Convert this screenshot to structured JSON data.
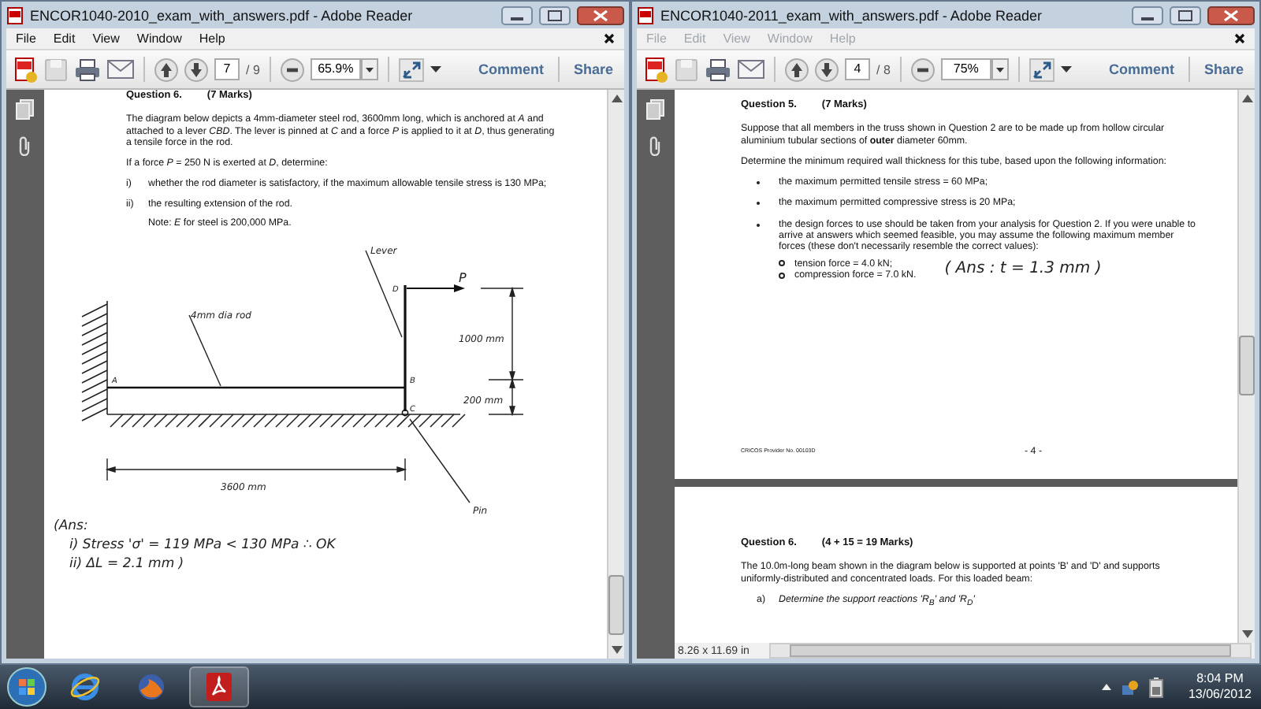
{
  "windows": [
    {
      "title": "ENCOR1040-2010_exam_with_answers.pdf - Adobe Reader",
      "menu": [
        "File",
        "Edit",
        "View",
        "Window",
        "Help"
      ],
      "menu_disabled": false,
      "page_number": "7",
      "page_count": "/ 9",
      "zoom": "65.9%",
      "comment": "Comment",
      "share": "Share"
    },
    {
      "title": "ENCOR1040-2011_exam_with_answers.pdf - Adobe Reader",
      "menu": [
        "File",
        "Edit",
        "View",
        "Window",
        "Help"
      ],
      "menu_disabled": true,
      "page_number": "4",
      "page_count": "/ 8",
      "zoom": "75%",
      "comment": "Comment",
      "share": "Share"
    }
  ],
  "left_document": {
    "heading": "Question 6.",
    "marks": "(7 Marks)",
    "paragraphs": [
      "The diagram below depicts a 4mm-diameter steel rod, 3600mm long, which is anchored at *A* and attached to a lever *CBD*. The lever is pinned at *C* and a force *P* is applied to it at *D*, thus generating a tensile force in the rod.",
      "If a force *P* = 250 N is exerted at *D*, determine:"
    ],
    "items": [
      {
        "marker": "i)",
        "text": "whether the rod diameter is satisfactory, if the maximum allowable tensile stress is 130 MPa;"
      },
      {
        "marker": "ii)",
        "text": "the resulting extension of the rod."
      }
    ],
    "note": "Note:  *E* for steel is 200,000 MPa.",
    "diagram": {
      "lever_label": "Lever",
      "force_label": "P",
      "point_d": "D",
      "rod_label": "4mm dia rod",
      "point_a": "A",
      "point_b": "B",
      "point_c": "C",
      "upper_height": "1000 mm",
      "lower_height": "200 mm",
      "length": "3600 mm",
      "pin_label": "Pin"
    },
    "answer": {
      "opening": "(Ans:",
      "lines": [
        "i)  Stress 'σ' = 119 MPa < 130 MPa ∴ OK",
        "ii)  ΔL = 2.1 mm )"
      ]
    }
  },
  "right_document": {
    "heading": "Question 5.",
    "marks": "(7 Marks)",
    "paragraphs": [
      "Suppose that all members in the truss shown in Question 2 are to be made up from hollow circular aluminium tubular sections of **outer** diameter 60mm.",
      "Determine the minimum required wall thickness for this tube, based upon the following information:"
    ],
    "bullets": [
      {
        "text": "the maximum permitted tensile stress = 60 MPa;"
      },
      {
        "text": "the maximum permitted compressive stress is 20 MPa;"
      },
      {
        "text": "the design forces to use should be taken from your analysis for Question 2. If you were unable to arrive at answers which seemed feasible, you may assume the following maximum member forces (these don't necessarily resemble the correct values):",
        "sub_items": [
          "tension force = 4.0 kN;",
          "compression force = 7.0 kN."
        ]
      }
    ],
    "answer": "( Ans :  t = 1.3 mm )",
    "footer_left": "CRICOS Provider No. 00103D",
    "footer_page": "- 4 -",
    "next_heading": "Question 6.",
    "next_marks": "(4 + 15 = 19 Marks)",
    "next_paragraph": "The 10.0m-long beam shown in the diagram below is supported at points 'B' and 'D' and supports uniformly-distributed and concentrated loads. For this loaded beam:",
    "next_item": {
      "marker": "a)",
      "text": "Determine the support reactions 'R$_{B}$' and 'R$_{D}$'"
    },
    "page_size": "8.26 x 11.69 in"
  },
  "taskbar": {
    "time": "8:04 PM",
    "date": "13/06/2012"
  }
}
